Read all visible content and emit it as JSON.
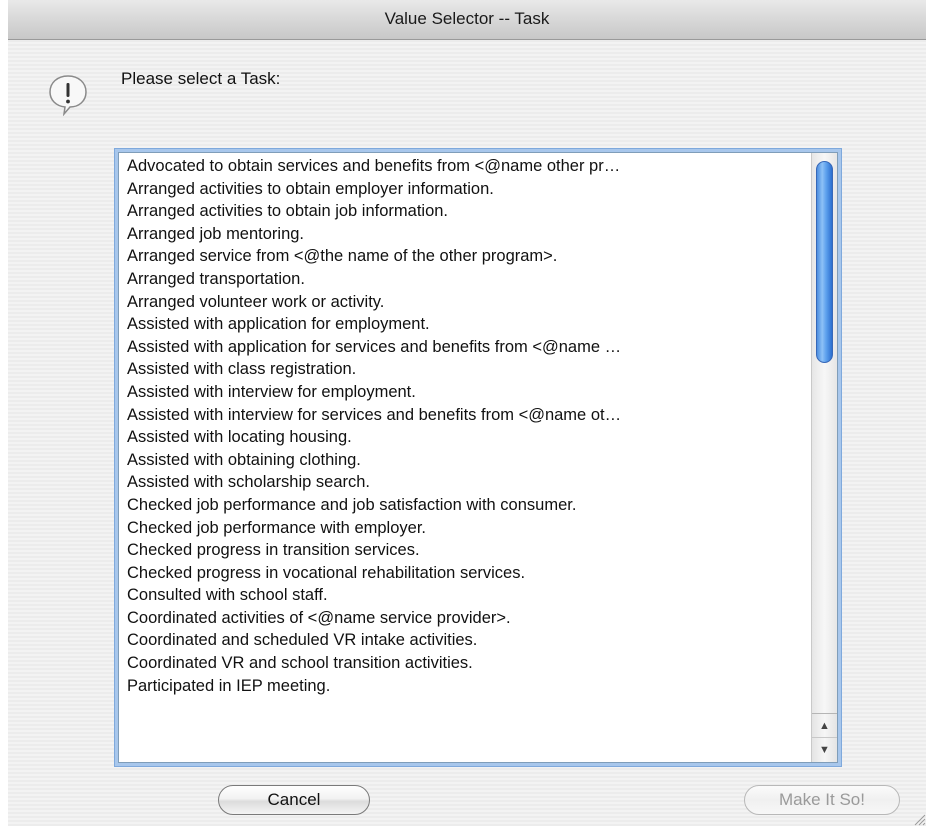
{
  "window": {
    "title": "Value Selector -- Task"
  },
  "dialog": {
    "prompt": "Please select a Task:",
    "icon": "alert-icon"
  },
  "tasks": [
    "Advocated to obtain services and benefits from <@name other pr…",
    "Arranged activities to obtain employer information.",
    "Arranged activities to obtain job information.",
    "Arranged job mentoring.",
    "Arranged service from <@the name of the other program>.",
    "Arranged transportation.",
    "Arranged volunteer work or activity.",
    "Assisted with application for employment.",
    "Assisted with application for services and benefits from <@name …",
    "Assisted with class registration.",
    "Assisted with interview for employment.",
    "Assisted with interview for services and benefits from <@name ot…",
    "Assisted with locating housing.",
    "Assisted with obtaining clothing.",
    "Assisted with scholarship search.",
    "Checked job performance and job satisfaction with consumer.",
    "Checked job performance with employer.",
    "Checked progress in transition services.",
    "Checked progress in vocational rehabilitation services.",
    "Consulted with school staff.",
    "Coordinated activities of <@name service provider>.",
    "Coordinated and scheduled VR intake activities.",
    "Coordinated VR and school transition activities.",
    "Participated in IEP meeting."
  ],
  "buttons": {
    "cancel_label": "Cancel",
    "ok_label": "Make It So!"
  },
  "scroll": {
    "position_fraction": 0.0
  }
}
